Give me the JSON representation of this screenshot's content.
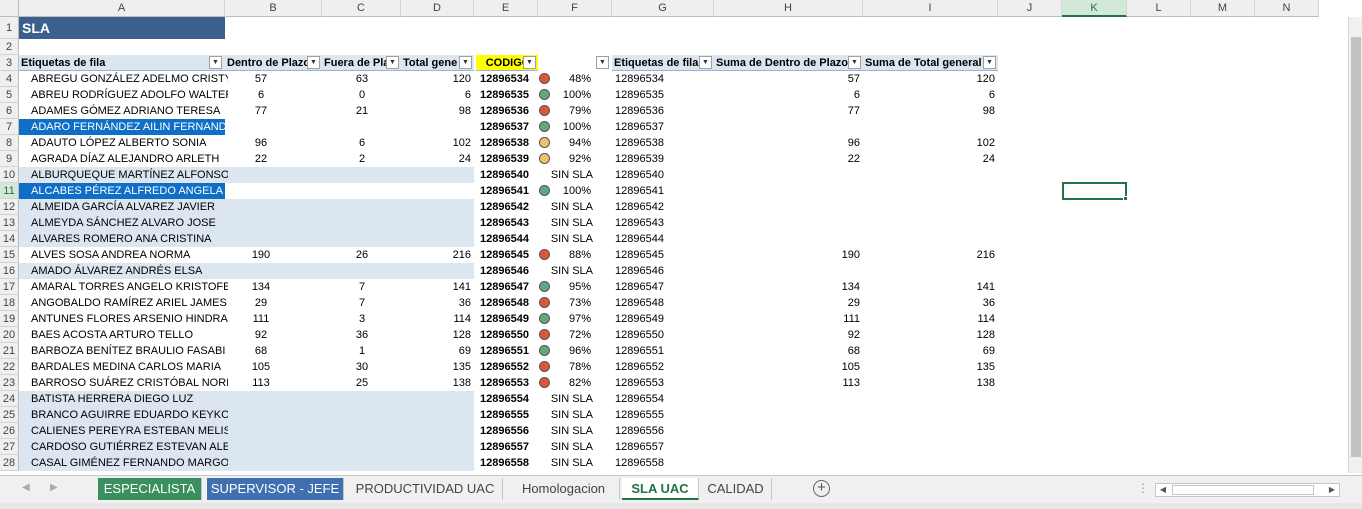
{
  "columns": [
    "A",
    "B",
    "C",
    "D",
    "E",
    "F",
    "G",
    "H",
    "I",
    "J",
    "K",
    "L",
    "M",
    "N"
  ],
  "selected_column": "K",
  "selected_row": "11",
  "title": "SLA",
  "headers": {
    "a": "Etiquetas de fila",
    "b": "Dentro de Plazo",
    "c": "Fuera de Pla",
    "d": "Total gene",
    "e": "CODIGO",
    "g": "Etiquetas de fila",
    "h": "Suma de Dentro de Plazo",
    "i": "Suma de Total general"
  },
  "rows": [
    {
      "rn": "4",
      "name": "ABREGU GONZÁLEZ ADELMO CRISTY",
      "b": "57",
      "c": "63",
      "d": "120",
      "code": "12896534",
      "status": "red",
      "pct": "48%",
      "g": "12896534",
      "h": "57",
      "i": "120"
    },
    {
      "rn": "5",
      "name": "ABREU RODRÍGUEZ ADOLFO WALTER",
      "b": "6",
      "c": "0",
      "d": "6",
      "code": "12896535",
      "status": "green",
      "pct": "100%",
      "g": "12896535",
      "h": "6",
      "i": "6"
    },
    {
      "rn": "6",
      "name": "ADAMES GÓMEZ ADRIANO TERESA",
      "b": "77",
      "c": "21",
      "d": "98",
      "code": "12896536",
      "status": "red",
      "pct": "79%",
      "g": "12896536",
      "h": "77",
      "i": "98"
    },
    {
      "rn": "7",
      "name": "ADARO FERNÁNDEZ AILIN FERNANDO",
      "b": "",
      "c": "",
      "d": "",
      "code": "12896537",
      "status": "green",
      "pct": "100%",
      "g": "12896537",
      "h": "",
      "i": "",
      "sel": true
    },
    {
      "rn": "8",
      "name": "ADAUTO LÓPEZ ALBERTO SONIA",
      "b": "96",
      "c": "6",
      "d": "102",
      "code": "12896538",
      "status": "yellow",
      "pct": "94%",
      "g": "12896538",
      "h": "96",
      "i": "102"
    },
    {
      "rn": "9",
      "name": "AGRADA DÍAZ ALEJANDRO ARLETH",
      "b": "22",
      "c": "2",
      "d": "24",
      "code": "12896539",
      "status": "yellow",
      "pct": "92%",
      "g": "12896539",
      "h": "22",
      "i": "24"
    },
    {
      "rn": "10",
      "name": "ALBURQUEQUE MARTÍNEZ ALFONSO MARITZA",
      "b": "",
      "c": "",
      "d": "",
      "code": "12896540",
      "status": "none",
      "pct": "SIN SLA",
      "g": "12896540",
      "h": "",
      "i": "",
      "band": true
    },
    {
      "rn": "11",
      "name": "ALCABES PÉREZ ALFREDO ANGELA",
      "b": "",
      "c": "",
      "d": "",
      "code": "12896541",
      "status": "green",
      "pct": "100%",
      "g": "12896541",
      "h": "",
      "i": "",
      "sel": true
    },
    {
      "rn": "12",
      "name": "ALMEIDA GARCÍA ALVAREZ JAVIER",
      "b": "",
      "c": "",
      "d": "",
      "code": "12896542",
      "status": "none",
      "pct": "SIN SLA",
      "g": "12896542",
      "h": "",
      "i": "",
      "band": true
    },
    {
      "rn": "13",
      "name": "ALMEYDA SÁNCHEZ ALVARO JOSE",
      "b": "",
      "c": "",
      "d": "",
      "code": "12896543",
      "status": "none",
      "pct": "SIN SLA",
      "g": "12896543",
      "h": "",
      "i": "",
      "band": true
    },
    {
      "rn": "14",
      "name": "ALVARES ROMERO ANA CRISTINA",
      "b": "",
      "c": "",
      "d": "",
      "code": "12896544",
      "status": "none",
      "pct": "SIN SLA",
      "g": "12896544",
      "h": "",
      "i": "",
      "band": true
    },
    {
      "rn": "15",
      "name": "ALVES SOSA ANDREA NORMA",
      "b": "190",
      "c": "26",
      "d": "216",
      "code": "12896545",
      "status": "red",
      "pct": "88%",
      "g": "12896545",
      "h": "190",
      "i": "216"
    },
    {
      "rn": "16",
      "name": "AMADO ÁLVAREZ ANDRÉS ELSA",
      "b": "",
      "c": "",
      "d": "",
      "code": "12896546",
      "status": "none",
      "pct": "SIN SLA",
      "g": "12896546",
      "h": "",
      "i": "",
      "band": true
    },
    {
      "rn": "17",
      "name": "AMARAL TORRES ANGELO KRISTOFER",
      "b": "134",
      "c": "7",
      "d": "141",
      "code": "12896547",
      "status": "green",
      "pct": "95%",
      "g": "12896547",
      "h": "134",
      "i": "141"
    },
    {
      "rn": "18",
      "name": "ANGOBALDO RAMÍREZ ARIEL JAMES",
      "b": "29",
      "c": "7",
      "d": "36",
      "code": "12896548",
      "status": "red",
      "pct": "73%",
      "g": "12896548",
      "h": "29",
      "i": "36"
    },
    {
      "rn": "19",
      "name": "ANTUNES FLORES ARSENIO HINDRA",
      "b": "111",
      "c": "3",
      "d": "114",
      "code": "12896549",
      "status": "green",
      "pct": "97%",
      "g": "12896549",
      "h": "111",
      "i": "114"
    },
    {
      "rn": "20",
      "name": "BAES ACOSTA ARTURO TELLO",
      "b": "92",
      "c": "36",
      "d": "128",
      "code": "12896550",
      "status": "red",
      "pct": "72%",
      "g": "12896550",
      "h": "92",
      "i": "128"
    },
    {
      "rn": "21",
      "name": "BARBOZA BENÍTEZ BRAULIO FASABI",
      "b": "68",
      "c": "1",
      "d": "69",
      "code": "12896551",
      "status": "green",
      "pct": "96%",
      "g": "12896551",
      "h": "68",
      "i": "69"
    },
    {
      "rn": "22",
      "name": "BARDALES MEDINA CARLOS MARIA",
      "b": "105",
      "c": "30",
      "d": "135",
      "code": "12896552",
      "status": "red",
      "pct": "78%",
      "g": "12896552",
      "h": "105",
      "i": "135"
    },
    {
      "rn": "23",
      "name": "BARROSO SUÁREZ CRISTÓBAL NORIS",
      "b": "113",
      "c": "25",
      "d": "138",
      "code": "12896553",
      "status": "red",
      "pct": "82%",
      "g": "12896553",
      "h": "113",
      "i": "138"
    },
    {
      "rn": "24",
      "name": "BATISTA HERRERA DIEGO LUZ",
      "b": "",
      "c": "",
      "d": "",
      "code": "12896554",
      "status": "none",
      "pct": "SIN SLA",
      "g": "12896554",
      "h": "",
      "i": "",
      "band": true
    },
    {
      "rn": "25",
      "name": "BRANCO AGUIRRE EDUARDO KEYKO",
      "b": "",
      "c": "",
      "d": "",
      "code": "12896555",
      "status": "none",
      "pct": "SIN SLA",
      "g": "12896555",
      "h": "",
      "i": "",
      "band": true
    },
    {
      "rn": "26",
      "name": "CALIENES PEREYRA ESTEBAN MELISSA",
      "b": "",
      "c": "",
      "d": "",
      "code": "12896556",
      "status": "none",
      "pct": "SIN SLA",
      "g": "12896556",
      "h": "",
      "i": "",
      "band": true
    },
    {
      "rn": "27",
      "name": "CARDOSO GUTIÉRREZ ESTEVAN ALEX",
      "b": "",
      "c": "",
      "d": "",
      "code": "12896557",
      "status": "none",
      "pct": "SIN SLA",
      "g": "12896557",
      "h": "",
      "i": "",
      "band": true
    },
    {
      "rn": "28",
      "name": "CASAL GIMÉNEZ FERNANDO MARGOTH",
      "b": "",
      "c": "",
      "d": "",
      "code": "12896558",
      "status": "none",
      "pct": "SIN SLA",
      "g": "12896558",
      "h": "",
      "i": "",
      "band": true
    }
  ],
  "status_colors": {
    "red": "#e0533c",
    "green": "#5fa882",
    "yellow": "#f0c36a"
  },
  "tabs": [
    {
      "label": "ESPECIALISTA",
      "style": "green"
    },
    {
      "label": "SUPERVISOR - JEFE",
      "style": "blue"
    },
    {
      "label": "PRODUCTIVIDAD UAC",
      "style": "plain"
    },
    {
      "label": "Homologacion",
      "style": "plain"
    },
    {
      "label": "SLA UAC",
      "style": "active"
    },
    {
      "label": "CALIDAD",
      "style": "plain"
    }
  ],
  "icons": {
    "add_sheet": "plus-circle-icon",
    "filter": "dropdown-arrow-icon"
  }
}
